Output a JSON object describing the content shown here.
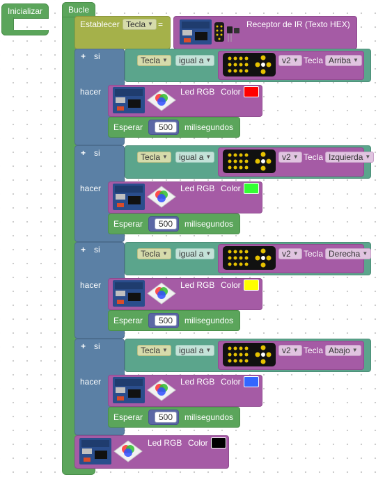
{
  "init_block": {
    "label": "Inicializar"
  },
  "loop_block": {
    "label": "Bucle"
  },
  "set_block": {
    "label": "Establecer",
    "variable": "Tecla",
    "equals": "=",
    "sensor_label": "Receptor de IR (Texto HEX)"
  },
  "if_blocks": [
    {
      "si_label": "si",
      "hacer_label": "hacer",
      "compare_var": "Tecla",
      "operator": "igual a",
      "remote_version": "v2",
      "tecla_label": "Tecla",
      "key": "Arriba",
      "led_label": "Led RGB",
      "color_label": "Color",
      "color": "#ff0000",
      "wait_label": "Esperar",
      "wait_value": "500",
      "wait_unit": "milisegundos"
    },
    {
      "si_label": "si",
      "hacer_label": "hacer",
      "compare_var": "Tecla",
      "operator": "igual a",
      "remote_version": "v2",
      "tecla_label": "Tecla",
      "key": "Izquierda",
      "led_label": "Led RGB",
      "color_label": "Color",
      "color": "#33ff33",
      "wait_label": "Esperar",
      "wait_value": "500",
      "wait_unit": "milisegundos"
    },
    {
      "si_label": "si",
      "hacer_label": "hacer",
      "compare_var": "Tecla",
      "operator": "igual a",
      "remote_version": "v2",
      "tecla_label": "Tecla",
      "key": "Derecha",
      "led_label": "Led RGB",
      "color_label": "Color",
      "color": "#ffff00",
      "wait_label": "Esperar",
      "wait_value": "500",
      "wait_unit": "milisegundos"
    },
    {
      "si_label": "si",
      "hacer_label": "hacer",
      "compare_var": "Tecla",
      "operator": "igual a",
      "remote_version": "v2",
      "tecla_label": "Tecla",
      "key": "Abajo",
      "led_label": "Led RGB",
      "color_label": "Color",
      "color": "#3366ff",
      "wait_label": "Esperar",
      "wait_value": "500",
      "wait_unit": "milisegundos"
    }
  ],
  "final_led": {
    "led_label": "Led RGB",
    "color_label": "Color",
    "color": "#000000"
  },
  "colors": {
    "control": "#5ba55b",
    "variable": "#a5b14a",
    "logic": "#5b80a5",
    "compare": "#5ba58c",
    "device": "#a55ba5",
    "math": "#5b67a5"
  }
}
